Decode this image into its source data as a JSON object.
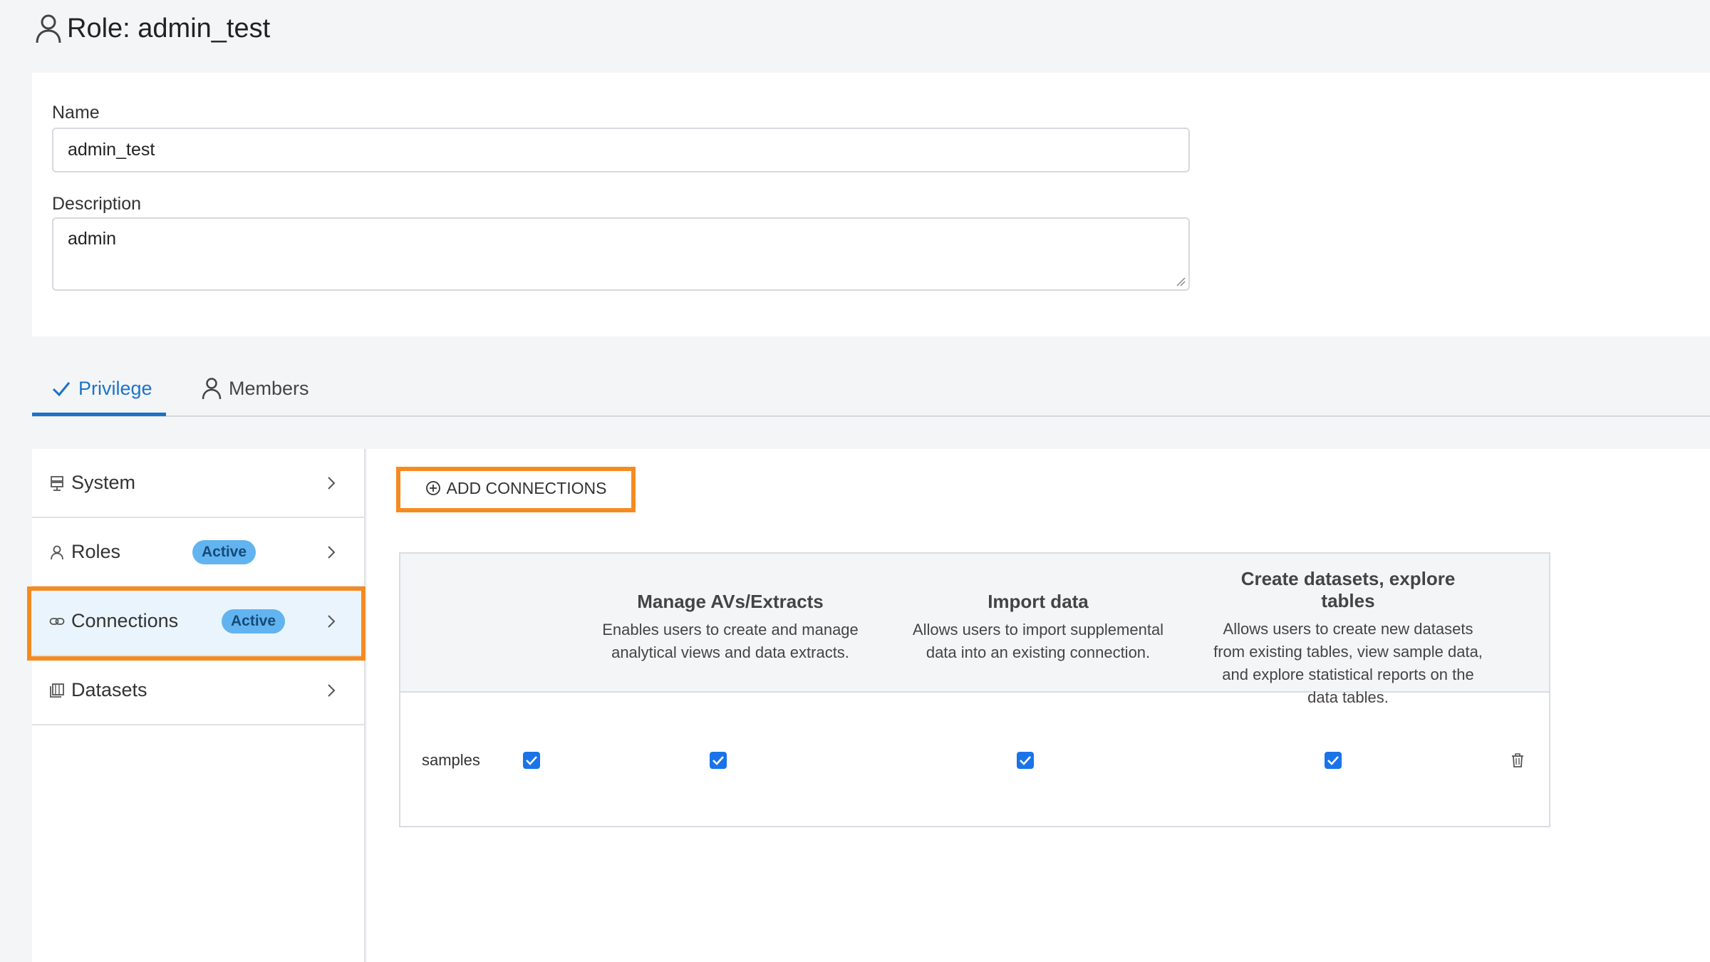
{
  "page": {
    "title": "Role: admin_test"
  },
  "form": {
    "name_label": "Name",
    "name_value": "admin_test",
    "description_label": "Description",
    "description_value": "admin"
  },
  "tabs": [
    {
      "label": "Privilege",
      "active": true
    },
    {
      "label": "Members",
      "active": false
    }
  ],
  "sidebar": {
    "items": [
      {
        "label": "System",
        "badge": ""
      },
      {
        "label": "Roles",
        "badge": "Active"
      },
      {
        "label": "Connections",
        "badge": "Active",
        "selected": true
      },
      {
        "label": "Datasets",
        "badge": ""
      }
    ]
  },
  "main": {
    "add_button_label": "ADD CONNECTIONS",
    "table": {
      "columns": [
        {
          "title": "Manage AVs/Extracts",
          "description": "Enables users to create and manage analytical views and data extracts."
        },
        {
          "title": "Import data",
          "description": "Allows users to import supplemental data into an existing connection."
        },
        {
          "title": "Create datasets, explore tables",
          "description": "Allows users to create new datasets from existing tables, view sample data, and explore statistical reports on the data tables."
        }
      ],
      "rows": [
        {
          "name": "samples",
          "checked": [
            true,
            true,
            true,
            true
          ]
        }
      ]
    }
  },
  "colors": {
    "accent": "#1a73c8",
    "highlight": "#f58b1f",
    "badge": "#62b4f0",
    "checkbox": "#1a73e8"
  }
}
